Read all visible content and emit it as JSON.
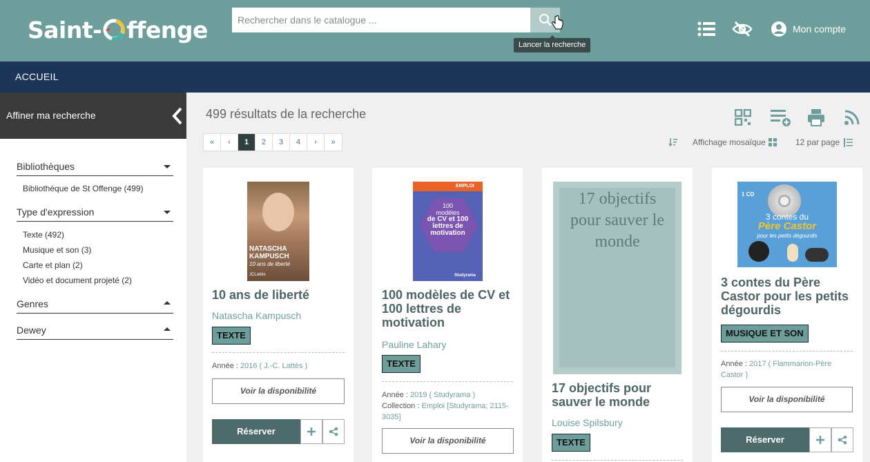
{
  "header": {
    "logo_part1": "Saint-",
    "logo_part2": "ffenge",
    "search_placeholder": "Rechercher dans le catalogue ...",
    "search_tooltip": "Lancer la recherche",
    "account_label": "Mon compte"
  },
  "nav": {
    "home": "ACCUEIL"
  },
  "sidebar": {
    "title": "Affiner ma recherche",
    "facets": [
      {
        "label": "Bibliothèques",
        "items": [
          "Bibliothèque de St Offenge (499)"
        ]
      },
      {
        "label": "Type d'expression",
        "items": [
          "Texte (492)",
          "Musique et son (3)",
          "Carte et plan (2)",
          "Vidéo et document projeté (2)"
        ]
      },
      {
        "label": "Genres",
        "items": []
      },
      {
        "label": "Dewey",
        "items": []
      }
    ]
  },
  "main": {
    "results_text": "499 résultats de la recherche",
    "pager": [
      "«",
      "‹",
      "1",
      "2",
      "3",
      "4",
      "›",
      "»"
    ],
    "display_mode": "Affichage mosaïque",
    "per_page": "12 par page"
  },
  "cards": [
    {
      "title": "10 ans de liberté",
      "author": "Natascha Kampusch",
      "type": "TEXTE",
      "year_label": "Année : ",
      "year": "2016",
      "publisher": "( J.-C. Lattès )",
      "cover_text": [
        "NATASCHA",
        "KAMPUSCH",
        "10 ans de liberté",
        "JCLattès"
      ],
      "availability": "Voir la disponibilité",
      "reserve": "Réserver"
    },
    {
      "title": "100 modèles de CV et 100 lettres de motivation",
      "author": "Pauline Lahary",
      "type": "TEXTE",
      "year_label": "Année : ",
      "year": "2019",
      "publisher": "( Studyrama )",
      "collection_label": "Collection : ",
      "collection": "Emploi [Studyrama; 2115-3035]",
      "cover_text": [
        "EMPLOI",
        "100",
        "modèles",
        "de CV et 100",
        "lettres de",
        "motivation",
        "Studyrama"
      ],
      "availability": "Voir la disponibilité"
    },
    {
      "title": "17 objectifs pour sauver le monde",
      "author": "Louise Spilsbury",
      "type": "TEXTE",
      "cover_text": "17 objectifs pour sauver le monde"
    },
    {
      "title": "3 contes du Père Castor pour les petits dégourdis",
      "author": "",
      "type": "MUSIQUE ET SON",
      "year_label": "Année : ",
      "year": "2017",
      "publisher": "( Flammarion-Père Castor )",
      "cover_text": [
        "1 CD",
        "3 contes du",
        "Père Castor",
        "pour les petits dégourdis"
      ],
      "availability": "Voir la disponibilité",
      "reserve": "Réserver"
    }
  ],
  "colors": {
    "header": "#6e9e9b",
    "nav": "#1c3558",
    "sidebar_head": "#3a3a3a",
    "accent": "#6e9e9b",
    "reserve": "#4d6b6b"
  }
}
